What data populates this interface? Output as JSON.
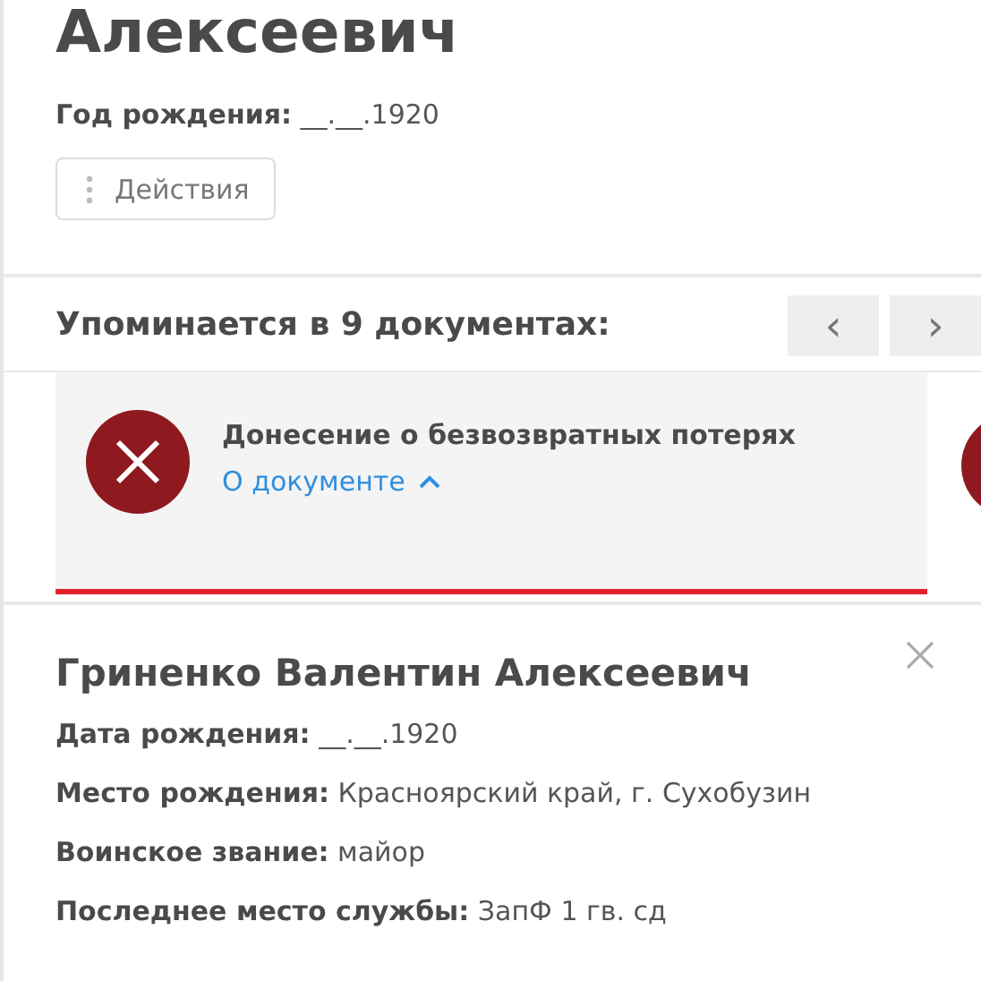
{
  "person": {
    "name": "Алексеевич",
    "fields": [
      {
        "label": "Год рождения:",
        "value": "__.__.1920"
      }
    ],
    "actions_button": "Действия"
  },
  "mentions": {
    "title": "Упоминается в 9 документах:",
    "prev": "‹",
    "next": "›",
    "documents": [
      {
        "title": "Донесение о безвозвратных потерях",
        "link": "О документе",
        "expanded": true
      }
    ]
  },
  "detail": {
    "name": "Гриненко Валентин Алексеевич",
    "fields": [
      {
        "label": "Дата рождения:",
        "value": "__.__.1920"
      },
      {
        "label": "Место рождения:",
        "value": "Красноярский край, г. Сухобузин"
      },
      {
        "label": "Воинское звание:",
        "value": "майор"
      },
      {
        "label": "Последнее место службы:",
        "value": "ЗапФ 1 гв. сд"
      }
    ]
  }
}
